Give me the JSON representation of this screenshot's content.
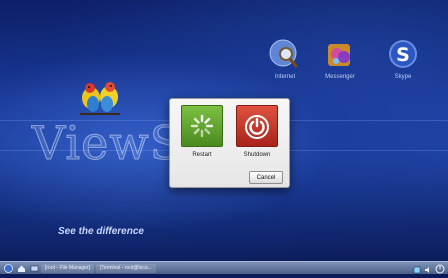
{
  "desktop": {
    "watermark_text": "ViewS",
    "tagline": "See the difference",
    "icons": [
      {
        "label": "Internet",
        "icon": "globe-search-icon"
      },
      {
        "label": "Messenger",
        "icon": "messenger-icon"
      },
      {
        "label": "Skype",
        "icon": "skype-icon"
      }
    ]
  },
  "dialog": {
    "restart_label": "Restart",
    "shutdown_label": "Shutdown",
    "cancel_label": "Cancel",
    "colors": {
      "restart": "#4b8a1f",
      "shutdown": "#a8231b"
    }
  },
  "taskbar": {
    "tasks": [
      {
        "label": "[root - File Manager]"
      },
      {
        "label": "[Terminal - root@loca..."
      }
    ]
  }
}
